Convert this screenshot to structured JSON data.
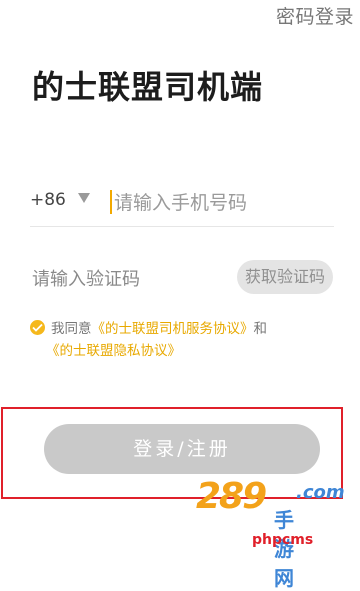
{
  "header": {
    "password_login": "密码登录"
  },
  "title": "的士联盟司机端",
  "phone": {
    "country_code": "+86",
    "placeholder": "请输入手机号码"
  },
  "code": {
    "placeholder": "请输入验证码",
    "get_code_label": "获取验证码"
  },
  "agreement": {
    "prefix": "我同意",
    "service_link": "《的士联盟司机服务协议》",
    "conjunction": "和",
    "privacy_link": "《的士联盟隐私协议》",
    "checked": true
  },
  "login_button": "登录/注册",
  "watermark": {
    "number": "289",
    "domain": ".com",
    "chinese": "手游网",
    "tag": "phpcms"
  },
  "colors": {
    "accent": "#f5b81c",
    "link": "#e8a900",
    "button_disabled": "#c9c9c9",
    "highlight_border": "#e0202a"
  }
}
